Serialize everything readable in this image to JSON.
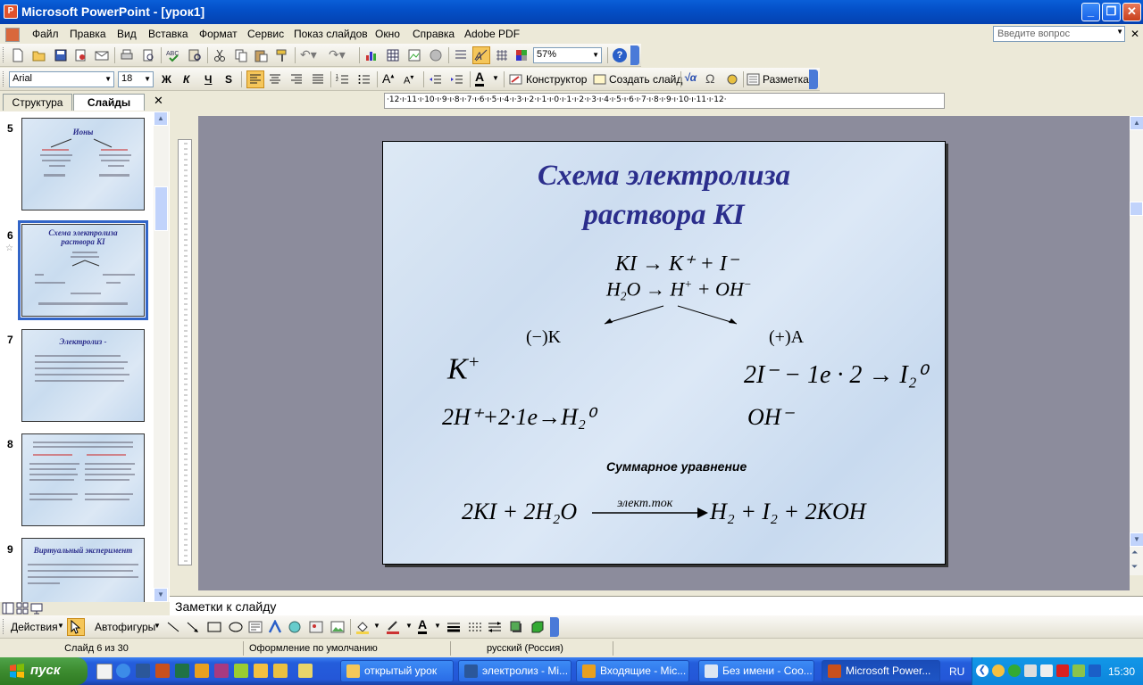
{
  "window": {
    "title": "Microsoft PowerPoint - [урок1]",
    "minimize": "_",
    "restore": "❐",
    "close": "✕"
  },
  "menu": {
    "items": [
      "Файл",
      "Правка",
      "Вид",
      "Вставка",
      "Формат",
      "Сервис",
      "Показ слайдов",
      "Окно",
      "Справка",
      "Adobe PDF"
    ],
    "help_placeholder": "Введите вопрос"
  },
  "toolbar_standard": {
    "zoom": "57%"
  },
  "toolbar_format": {
    "font": "Arial",
    "size": "18",
    "bold": "Ж",
    "italic": "К",
    "underline": "Ч",
    "shadow": "S",
    "designer": "Конструктор",
    "new_slide": "Создать слайд",
    "layout": "Разметка"
  },
  "panel": {
    "tab_outline": "Структура",
    "tab_slides": "Слайды",
    "close": "✕",
    "thumbnails": [
      {
        "num": "5",
        "title": "Ионы"
      },
      {
        "num": "6",
        "title": "Схема электролиза раствора KI"
      },
      {
        "num": "7",
        "title": "Электролиз -"
      },
      {
        "num": "8",
        "title": ""
      },
      {
        "num": "9",
        "title": "Виртуальный эксперимент"
      }
    ]
  },
  "ruler": {
    "horizontal": "·12·ı·11·ı·10·ı·9·ı·8·ı·7·ı·6·ı·5·ı·4·ı·3·ı·2·ı·1·ı·0·ı·1·ı·2·ı·3·ı·4·ı·5·ı·6·ı·7·ı·8·ı·9·ı·10·ı·11·ı·12·"
  },
  "slide": {
    "title_line1": "Схема электролиза",
    "title_line2": "раствора KI",
    "dissociation1": "KI → K⁺ + I⁻",
    "dissociation2_a": "H",
    "dissociation2_b": "O → H",
    "dissociation2_c": " + OH",
    "cathode_label": "(−)K",
    "anode_label": "(+)A",
    "cathode_ion": "K",
    "cathode_reaction": "2H⁺+2·1e→H₂⁰",
    "anode_reaction": "2I⁻ − 1e · 2 → I₂⁰",
    "anode_ion": "OH⁻",
    "summary_label": "Суммарное уравнение",
    "over_arrow": "элект.ток",
    "summary_left": "2KI + 2H₂O",
    "summary_right": "H₂ + I₂ + 2KOH"
  },
  "notes": {
    "placeholder": "Заметки к слайду"
  },
  "drawing": {
    "actions": "Действия",
    "autoshapes": "Автофигуры"
  },
  "status": {
    "slide": "Слайд 6 из 30",
    "design": "Оформление по умолчанию",
    "language": "русский (Россия)"
  },
  "taskbar": {
    "start": "пуск",
    "tasks": [
      "открытый урок",
      "электролиз - Mi...",
      "Входящие - Mic...",
      "Без имени - Соо...",
      "Microsoft Power..."
    ],
    "lang": "RU",
    "clock": "15:30"
  }
}
